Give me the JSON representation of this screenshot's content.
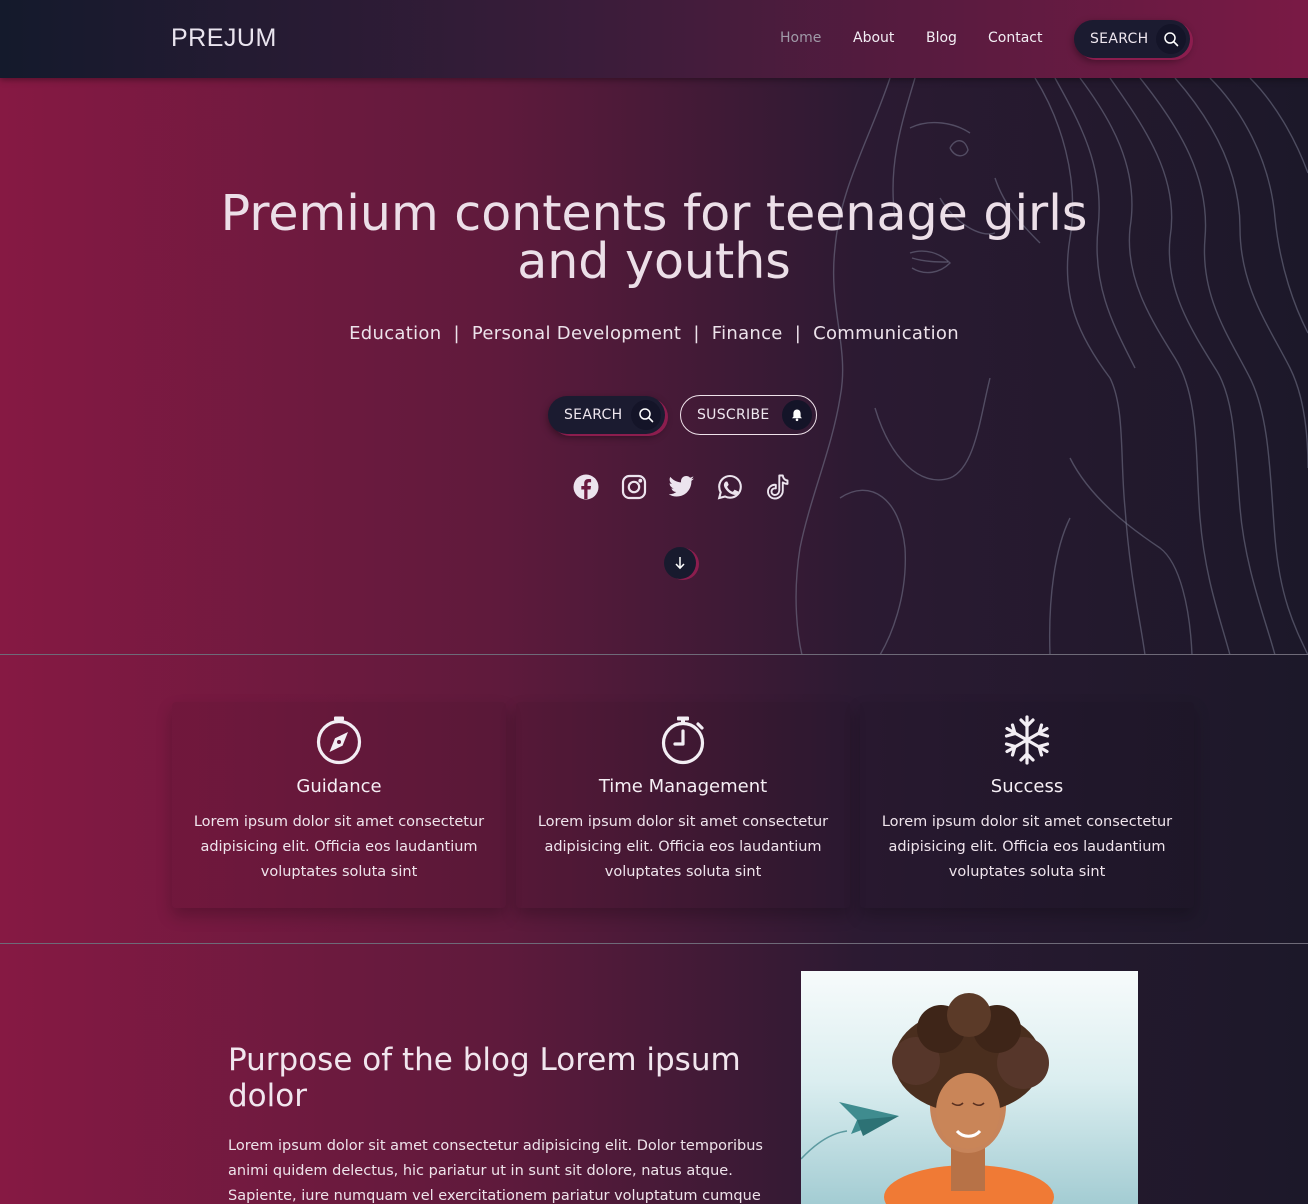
{
  "brand": "PREJUM",
  "nav": {
    "links": [
      {
        "label": "Home",
        "active": true
      },
      {
        "label": "About",
        "active": false
      },
      {
        "label": "Blog",
        "active": false
      },
      {
        "label": "Contact",
        "active": false
      }
    ],
    "search_label": "SEARCH"
  },
  "hero": {
    "title_line1": "Premium contents for teenage girls",
    "title_line2": "and youths",
    "topics": [
      "Education",
      "Personal Development",
      "Finance",
      "Communication"
    ],
    "topics_separator": "|",
    "search_label": "SEARCH",
    "subscribe_label": "SUSCRIBE",
    "socials": [
      "facebook-icon",
      "instagram-icon",
      "twitter-icon",
      "whatsapp-icon",
      "tiktok-icon"
    ],
    "scroll_icon": "arrow-down-icon"
  },
  "features": [
    {
      "icon": "compass-icon",
      "title": "Guidance",
      "text": "Lorem ipsum dolor sit amet consectetur adipisicing elit. Officia eos laudantium voluptates soluta sint"
    },
    {
      "icon": "stopwatch-icon",
      "title": "Time Management",
      "text": "Lorem ipsum dolor sit amet consectetur adipisicing elit. Officia eos laudantium voluptates soluta sint"
    },
    {
      "icon": "snowflake-icon",
      "title": "Success",
      "text": "Lorem ipsum dolor sit amet consectetur adipisicing elit. Officia eos laudantium voluptates soluta sint"
    }
  ],
  "blog": {
    "title": "Purpose of the blog Lorem ipsum dolor",
    "text": "Lorem ipsum dolor sit amet consectetur adipisicing elit. Dolor temporibus animi quidem delectus, hic pariatur ut in sunt sit dolore, natus atque. Sapiente, iure numquam vel exercitationem pariatur voluptatum cumque"
  },
  "colors": {
    "accent": "#8c1d4e",
    "gradient_left": "#861943",
    "gradient_right": "#1c1829",
    "nav_dark": "#141a2c",
    "button_dark": "#1b1b30"
  }
}
